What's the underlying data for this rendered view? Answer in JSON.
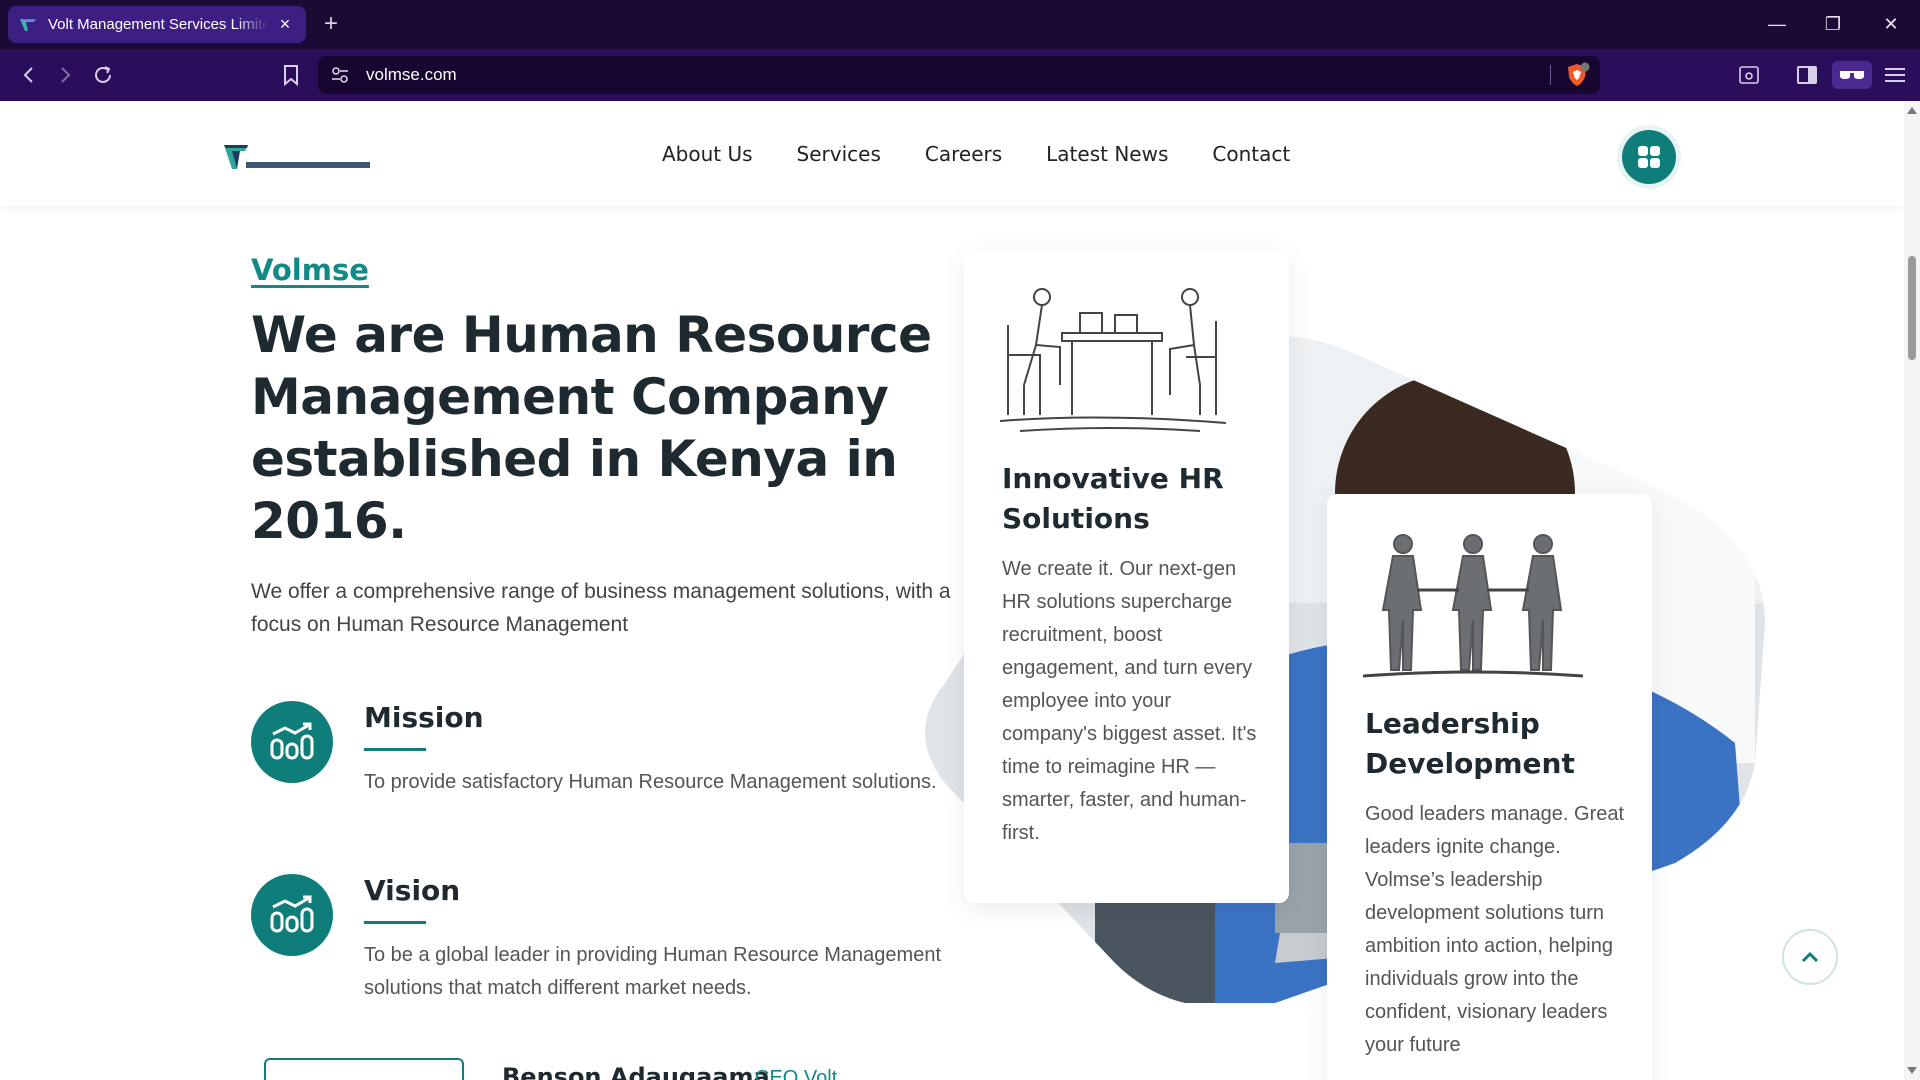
{
  "browser": {
    "tab_title": "Volt Management Services Limited",
    "tab_close": "×",
    "new_tab": "+",
    "url": "volmse.com",
    "window_minimize": "—",
    "window_restore": "❐",
    "window_close": "✕"
  },
  "header": {
    "nav": [
      "About Us",
      "Services",
      "Careers",
      "Latest News",
      "Contact"
    ]
  },
  "hero": {
    "eyebrow": "Volmse",
    "headline": "We are Human Resource Management Company established in Kenya in 2016.",
    "intro": "We offer a comprehensive range of business management solutions, with a focus on Human Resource Management"
  },
  "features": [
    {
      "title": "Mission",
      "text": "To provide satisfactory Human Resource Management solutions."
    },
    {
      "title": "Vision",
      "text": "To be a global leader in providing Human Resource Management solutions that match different market needs."
    }
  ],
  "author": {
    "name": "Benson Adaugaama",
    "role": "CEO Volt"
  },
  "cards": [
    {
      "title": "Innovative HR Solutions",
      "text": "We create it. Our next-gen HR solutions supercharge recruitment, boost engagement, and turn every employee into your company's biggest asset. It's time to reimagine HR — smarter, faster, and human-first."
    },
    {
      "title": "Leadership Development",
      "text": "Good leaders manage. Great leaders ignite change. Volmse’s leadership development solutions turn ambition into action, helping individuals grow into the confident, visionary leaders your future"
    }
  ],
  "colors": {
    "brand": "#0f7e7b",
    "tab_strip": "#1b0a33",
    "toolbar": "#2a0e5c",
    "active_tab": "#3d1f83"
  }
}
